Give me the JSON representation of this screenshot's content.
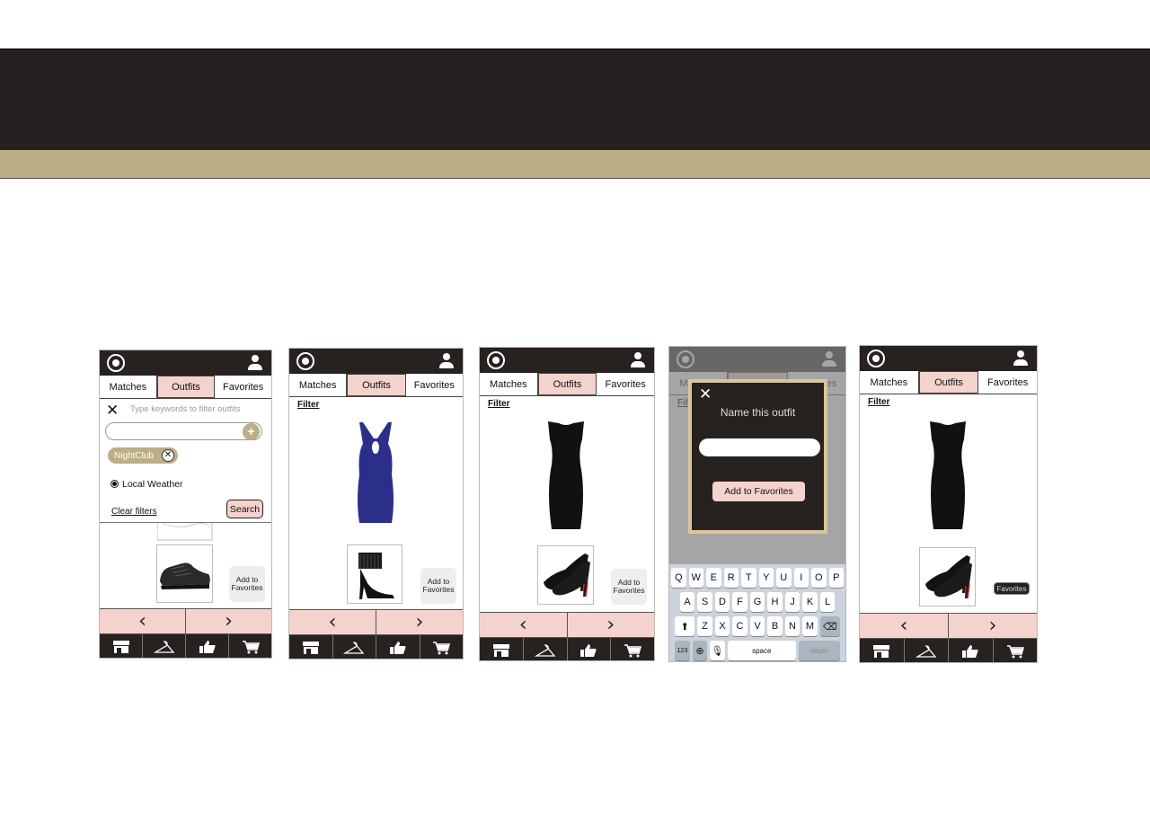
{
  "header": {
    "background": "#262120",
    "accent": "#bdae86"
  },
  "colors": {
    "pink": "#f4d3cd",
    "gold": "#bdae86",
    "dark": "#272120"
  },
  "tabs": [
    "Matches",
    "Outfits",
    "Favorites"
  ],
  "active_tab": "Outfits",
  "filter_link": "Filter",
  "nav": {
    "prev": "‹",
    "next": "›"
  },
  "bottom_icons": [
    "store-icon",
    "hanger-icon",
    "thumbs-up-icon",
    "cart-icon"
  ],
  "screen1": {
    "filter_hint": "Type keywords to filter outfits",
    "tag": "NightClub",
    "radio_label": "Local Weather",
    "clear": "Clear filters",
    "search": "Search",
    "fav_button": "Add to Favorites"
  },
  "screen2": {
    "fav_button": "Add to Favorites"
  },
  "screen3": {
    "fav_button": "Add to Favorites"
  },
  "screen4": {
    "modal_title": "Name this outfit",
    "modal_button": "Add to Favorites",
    "keyboard": {
      "row1": [
        "Q",
        "W",
        "E",
        "R",
        "T",
        "Y",
        "U",
        "I",
        "O",
        "P"
      ],
      "row2": [
        "A",
        "S",
        "D",
        "F",
        "G",
        "H",
        "J",
        "K",
        "L"
      ],
      "row3": [
        "Z",
        "X",
        "C",
        "V",
        "B",
        "N",
        "M"
      ],
      "numbers": "123",
      "space": "space",
      "return": "return"
    }
  },
  "screen5": {
    "fav_badge": "Favorites"
  }
}
